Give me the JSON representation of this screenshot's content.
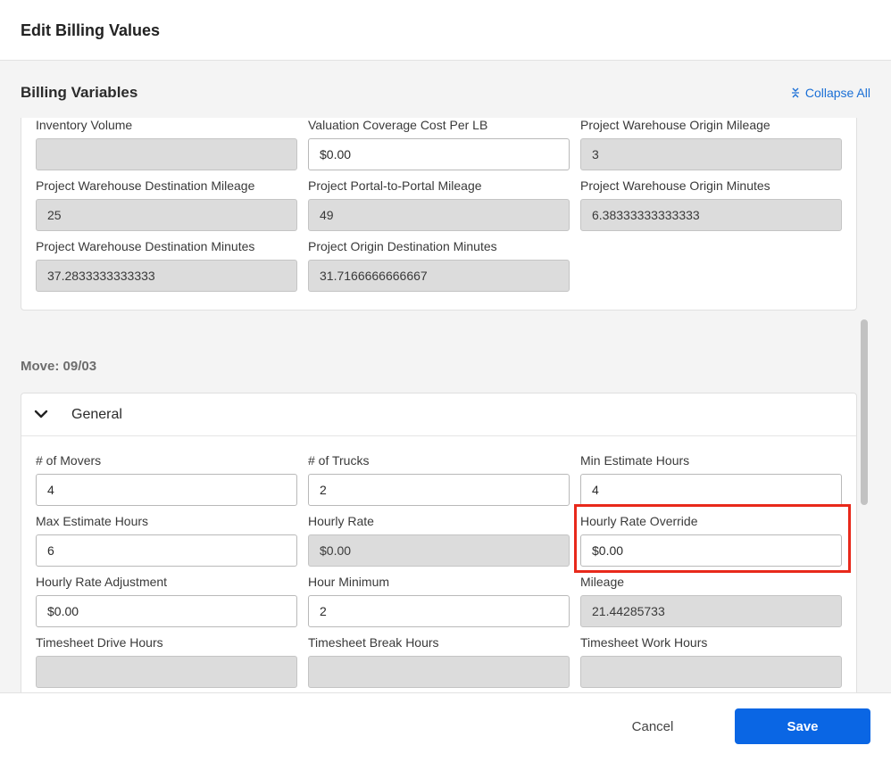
{
  "modal": {
    "title": "Edit Billing Values"
  },
  "billing_variables": {
    "title": "Billing Variables",
    "collapse_all_label": "Collapse All",
    "fields": [
      {
        "label": "Inventory Volume",
        "value": "",
        "disabled": true
      },
      {
        "label": "Valuation Coverage Cost Per LB",
        "value": "$0.00",
        "disabled": false
      },
      {
        "label": "Project Warehouse Origin Mileage",
        "value": "3",
        "disabled": true
      },
      {
        "label": "Project Warehouse Destination Mileage",
        "value": "25",
        "disabled": true
      },
      {
        "label": "Project Portal-to-Portal Mileage",
        "value": "49",
        "disabled": true
      },
      {
        "label": "Project Warehouse Origin Minutes",
        "value": "6.38333333333333",
        "disabled": true
      },
      {
        "label": "Project Warehouse Destination Minutes",
        "value": "37.2833333333333",
        "disabled": true
      },
      {
        "label": "Project Origin Destination Minutes",
        "value": "31.7166666666667",
        "disabled": true
      }
    ]
  },
  "move": {
    "label": "Move: 09/03",
    "general": {
      "title": "General",
      "fields": [
        {
          "label": "# of Movers",
          "value": "4",
          "disabled": false
        },
        {
          "label": "# of Trucks",
          "value": "2",
          "disabled": false
        },
        {
          "label": "Min Estimate Hours",
          "value": "4",
          "disabled": false
        },
        {
          "label": "Max Estimate Hours",
          "value": "6",
          "disabled": false
        },
        {
          "label": "Hourly Rate",
          "value": "$0.00",
          "disabled": true
        },
        {
          "label": "Hourly Rate Override",
          "value": "$0.00",
          "disabled": false
        },
        {
          "label": "Hourly Rate Adjustment",
          "value": "$0.00",
          "disabled": false
        },
        {
          "label": "Hour Minimum",
          "value": "2",
          "disabled": false
        },
        {
          "label": "Mileage",
          "value": "21.44285733",
          "disabled": true
        },
        {
          "label": "Timesheet Drive Hours",
          "value": "",
          "disabled": true
        },
        {
          "label": "Timesheet Break Hours",
          "value": "",
          "disabled": true
        },
        {
          "label": "Timesheet Work Hours",
          "value": "",
          "disabled": true
        }
      ]
    }
  },
  "footer": {
    "cancel_label": "Cancel",
    "save_label": "Save"
  },
  "colors": {
    "accent": "#0a66e4",
    "link": "#1a6fd6",
    "highlight": "#e8291b"
  }
}
